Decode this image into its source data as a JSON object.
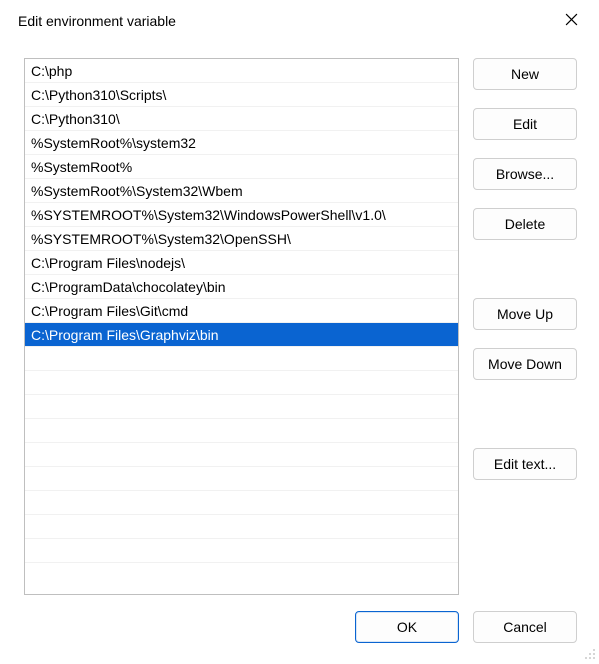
{
  "title": "Edit environment variable",
  "entries": [
    "C:\\php",
    "C:\\Python310\\Scripts\\",
    "C:\\Python310\\",
    "%SystemRoot%\\system32",
    "%SystemRoot%",
    "%SystemRoot%\\System32\\Wbem",
    "%SYSTEMROOT%\\System32\\WindowsPowerShell\\v1.0\\",
    "%SYSTEMROOT%\\System32\\OpenSSH\\",
    "C:\\Program Files\\nodejs\\",
    "C:\\ProgramData\\chocolatey\\bin",
    "C:\\Program Files\\Git\\cmd",
    "C:\\Program Files\\Graphviz\\bin"
  ],
  "selected_index": 11,
  "buttons": {
    "new": "New",
    "edit": "Edit",
    "browse": "Browse...",
    "delete": "Delete",
    "move_up": "Move Up",
    "move_down": "Move Down",
    "edit_text": "Edit text...",
    "ok": "OK",
    "cancel": "Cancel"
  }
}
